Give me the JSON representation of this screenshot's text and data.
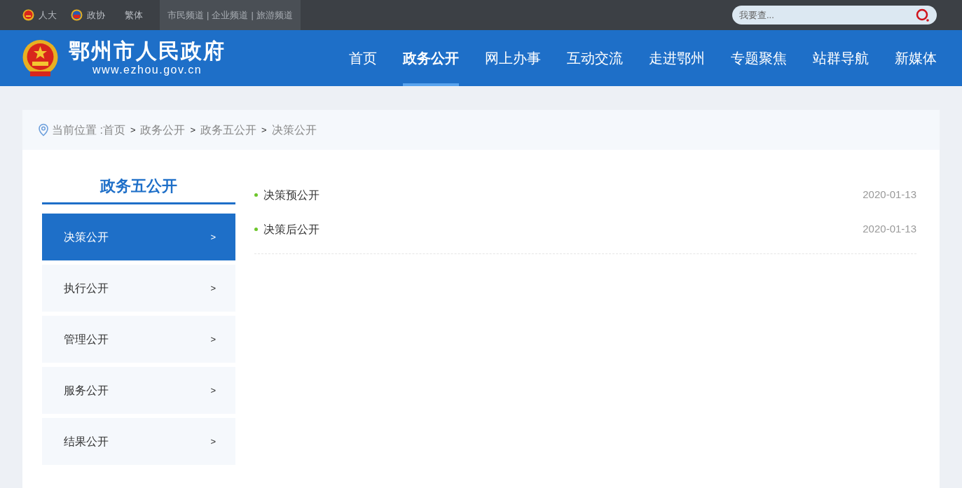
{
  "topbar": {
    "links": [
      {
        "label": "人大",
        "kind": "emblem"
      },
      {
        "label": "政协",
        "kind": "cppcc"
      },
      {
        "label": "繁体",
        "kind": "plain"
      }
    ],
    "channels": [
      "市民频道",
      "企业频道",
      "旅游频道"
    ],
    "channel_separator": "|",
    "search": {
      "placeholder": "我要查..."
    }
  },
  "header": {
    "title": "鄂州市人民政府",
    "url": "www.ezhou.gov.cn",
    "nav": [
      {
        "label": "首页",
        "selected": false
      },
      {
        "label": "政务公开",
        "selected": true
      },
      {
        "label": "网上办事",
        "selected": false
      },
      {
        "label": "互动交流",
        "selected": false
      },
      {
        "label": "走进鄂州",
        "selected": false
      },
      {
        "label": "专题聚焦",
        "selected": false
      },
      {
        "label": "站群导航",
        "selected": false
      },
      {
        "label": "新媒体",
        "selected": false
      }
    ]
  },
  "breadcrumb": {
    "label": "当前位置 :",
    "separator": ">",
    "items": [
      "首页",
      "政务公开",
      "政务五公开",
      "决策公开"
    ]
  },
  "sidebar": {
    "title": "政务五公开",
    "items": [
      {
        "label": "决策公开",
        "arrow": ">",
        "selected": true
      },
      {
        "label": "执行公开",
        "arrow": ">",
        "selected": false
      },
      {
        "label": "管理公开",
        "arrow": ">",
        "selected": false
      },
      {
        "label": "服务公开",
        "arrow": ">",
        "selected": false
      },
      {
        "label": "结果公开",
        "arrow": ">",
        "selected": false
      }
    ]
  },
  "list": [
    {
      "title": "决策预公开",
      "date": "2020-01-13"
    },
    {
      "title": "决策后公开",
      "date": "2020-01-13"
    }
  ]
}
